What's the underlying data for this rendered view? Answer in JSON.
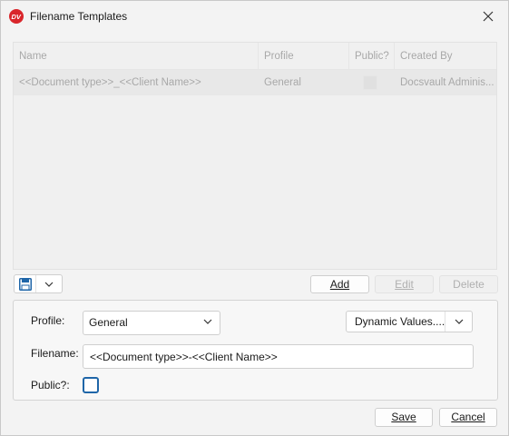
{
  "window": {
    "title": "Filename Templates",
    "app_icon": "docsvault-logo-icon",
    "close_icon": "close-icon"
  },
  "grid": {
    "columns": [
      "Name",
      "Profile",
      "Public?",
      "Created By"
    ],
    "rows": [
      {
        "name": "<<Document type>>_<<Client Name>>",
        "profile": "General",
        "public": false,
        "created_by": "Docsvault Adminis..."
      }
    ]
  },
  "toolbar": {
    "save_icon": "save-icon",
    "dropdown_icon": "chevron-down-icon",
    "add_label": "Add",
    "edit_label": "Edit",
    "delete_label": "Delete"
  },
  "form": {
    "profile_label": "Profile:",
    "profile_value": "General",
    "dynamic_values_label": "Dynamic Values....",
    "filename_label": "Filename:",
    "filename_value": "<<Document type>>-<<Client Name>>",
    "public_label": "Public?:",
    "public_checked": false
  },
  "footer": {
    "save_label": "Save",
    "cancel_label": "Cancel"
  },
  "colors": {
    "accent": "#1f66a8",
    "brand_red": "#d9262b"
  }
}
